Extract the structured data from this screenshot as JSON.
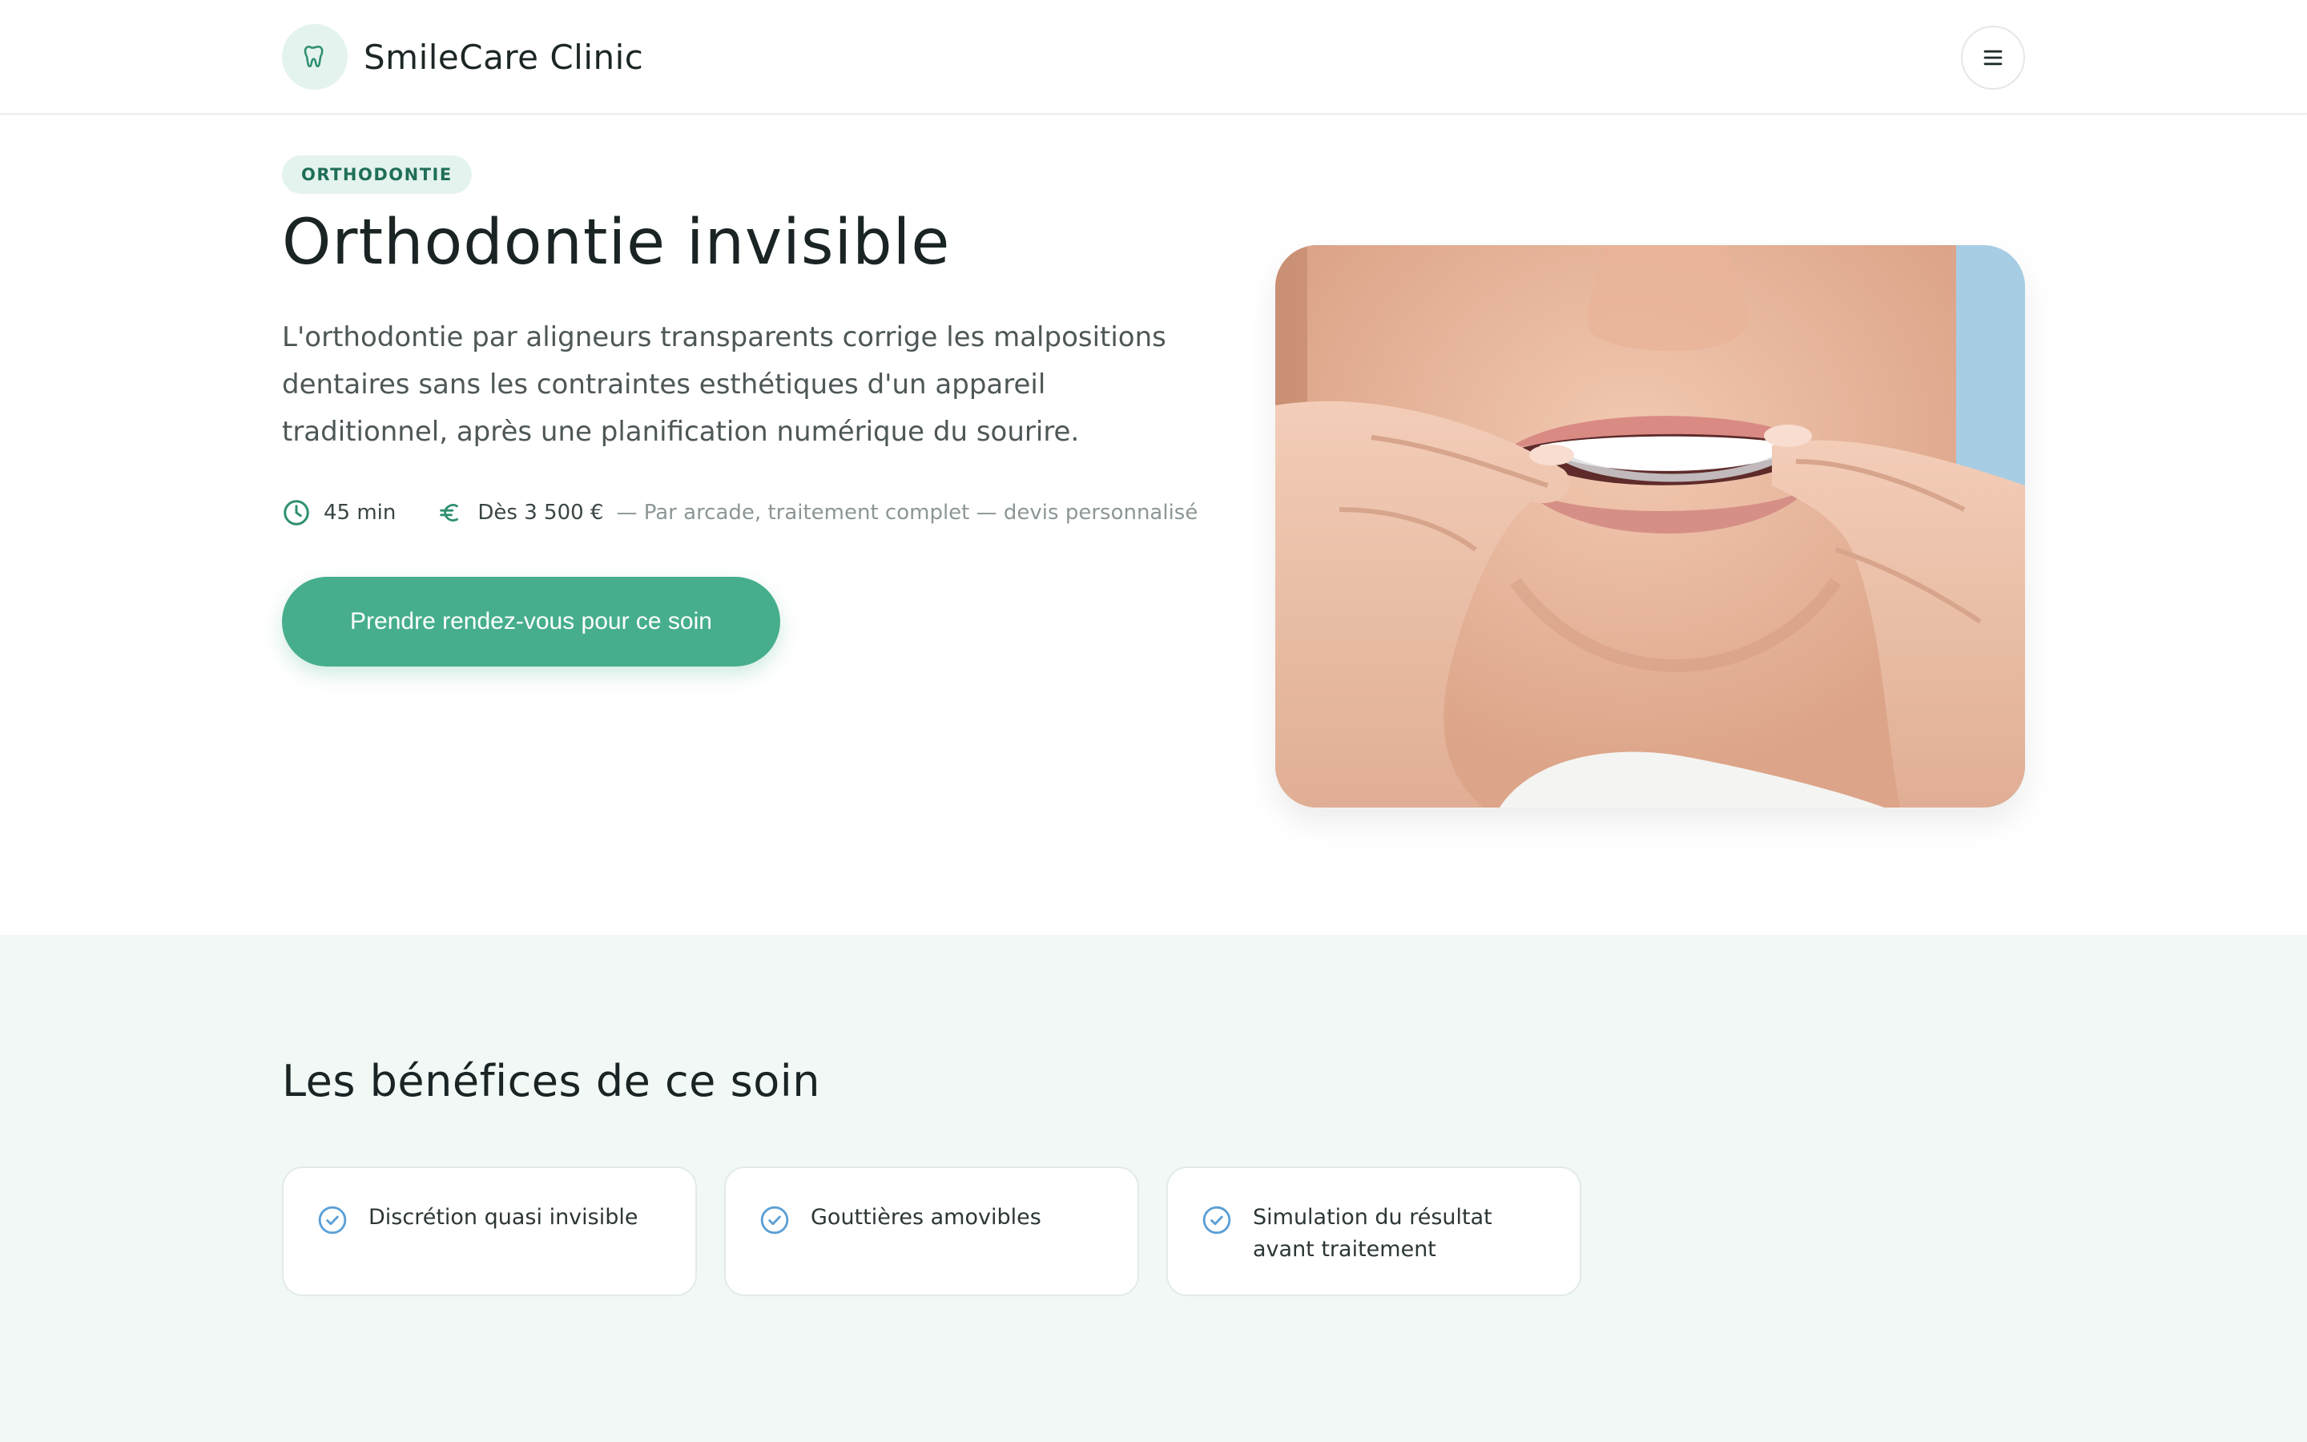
{
  "brand": {
    "name": "SmileCare Clinic",
    "logo_icon": "tooth-icon"
  },
  "header": {
    "menu_icon": "hamburger-menu-icon"
  },
  "hero": {
    "tag": "ORTHODONTIE",
    "title": "Orthodontie invisible",
    "description": "L'orthodontie par aligneurs transparents corrige les malpositions dentaires sans les contraintes esthétiques d'un appareil traditionnel, après une planification numérique du sourire.",
    "duration": "45 min",
    "duration_icon": "clock-icon",
    "price": "Dès 3 500 €",
    "price_icon": "euro-icon",
    "price_note": "— Par arcade, traitement complet — devis personnalisé",
    "cta_label": "Prendre rendez-vous pour ce soin"
  },
  "benefits": {
    "title": "Les bénéfices de ce soin",
    "items": [
      {
        "label": "Discrétion quasi invisible",
        "icon": "check-circle-icon"
      },
      {
        "label": "Gouttières amovibles",
        "icon": "check-circle-icon"
      },
      {
        "label": "Simulation du résultat avant traitement",
        "icon": "check-circle-icon"
      }
    ]
  },
  "colors": {
    "accent": "#46ae8d",
    "accent_soft": "#e4f3ee",
    "tag_text": "#1f6e58",
    "section_bg": "#f1f8f5",
    "check_icon": "#5a9fd6"
  }
}
